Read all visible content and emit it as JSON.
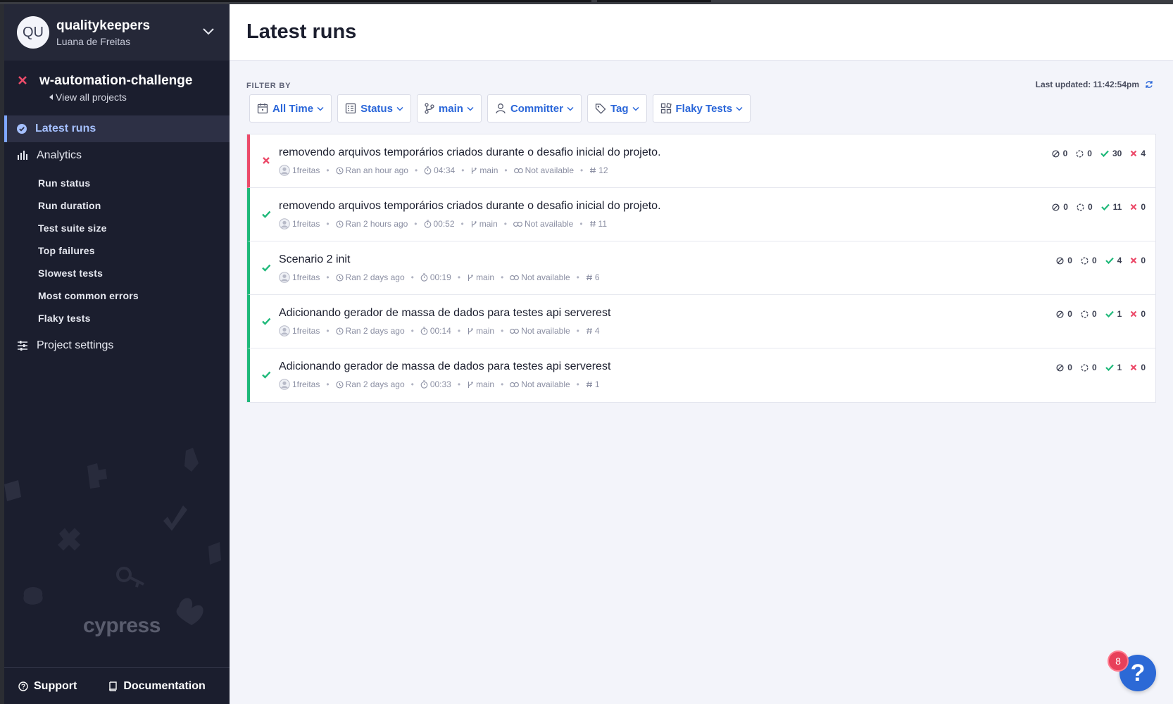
{
  "org": {
    "initials": "QU",
    "name": "qualitykeepers",
    "user": "Luana de Freitas"
  },
  "project": {
    "name": "w-automation-challenge",
    "view_all": "View all projects"
  },
  "nav": {
    "latest_runs": "Latest runs",
    "analytics": "Analytics",
    "analytics_items": [
      "Run status",
      "Run duration",
      "Test suite size",
      "Top failures",
      "Slowest tests",
      "Most common errors",
      "Flaky tests"
    ],
    "project_settings": "Project settings"
  },
  "footer": {
    "support": "Support",
    "documentation": "Documentation"
  },
  "brand_watermark": "cypress",
  "page": {
    "title": "Latest runs"
  },
  "filters": {
    "label": "FILTER BY",
    "last_updated": "Last updated: 11:42:54pm",
    "buttons": [
      "All Time",
      "Status",
      "main",
      "Committer",
      "Tag",
      "Flaky Tests"
    ]
  },
  "runs": [
    {
      "status": "failed",
      "commit": "removendo arquivos temporários criados durante o desafio inicial do projeto.",
      "author": "1freitas",
      "ran": "Ran an hour ago",
      "duration": "04:34",
      "branch": "main",
      "ci": "Not available",
      "number": "12",
      "skipped": "0",
      "pending": "0",
      "passed": "30",
      "failed": "4"
    },
    {
      "status": "passed",
      "commit": "removendo arquivos temporários criados durante o desafio inicial do projeto.",
      "author": "1freitas",
      "ran": "Ran 2 hours ago",
      "duration": "00:52",
      "branch": "main",
      "ci": "Not available",
      "number": "11",
      "skipped": "0",
      "pending": "0",
      "passed": "11",
      "failed": "0"
    },
    {
      "status": "passed",
      "commit": "Scenario 2 init",
      "author": "1freitas",
      "ran": "Ran 2 days ago",
      "duration": "00:19",
      "branch": "main",
      "ci": "Not available",
      "number": "6",
      "skipped": "0",
      "pending": "0",
      "passed": "4",
      "failed": "0"
    },
    {
      "status": "passed",
      "commit": "Adicionando gerador de massa de dados para testes api serverest",
      "author": "1freitas",
      "ran": "Ran 2 days ago",
      "duration": "00:14",
      "branch": "main",
      "ci": "Not available",
      "number": "4",
      "skipped": "0",
      "pending": "0",
      "passed": "1",
      "failed": "0"
    },
    {
      "status": "passed",
      "commit": "Adicionando gerador de massa de dados para testes api serverest",
      "author": "1freitas",
      "ran": "Ran 2 days ago",
      "duration": "00:33",
      "branch": "main",
      "ci": "Not available",
      "number": "1",
      "skipped": "0",
      "pending": "0",
      "passed": "1",
      "failed": "0"
    }
  ],
  "help": {
    "badge": "8",
    "label": "?"
  },
  "colors": {
    "pass": "#1fb97a",
    "fail": "#ec4b6a",
    "accent": "#2a66d9",
    "sidebar": "#1b1e2e"
  }
}
